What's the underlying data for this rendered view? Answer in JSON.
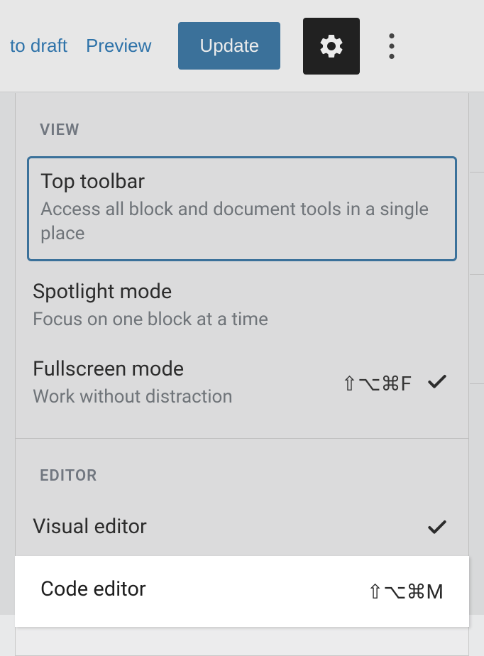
{
  "topbar": {
    "draft_label": "to draft",
    "preview_label": "Preview",
    "update_label": "Update"
  },
  "menu": {
    "view": {
      "section_title": "VIEW",
      "top_toolbar": {
        "title": "Top toolbar",
        "desc": "Access all block and document tools in a single place"
      },
      "spotlight": {
        "title": "Spotlight mode",
        "desc": "Focus on one block at a time"
      },
      "fullscreen": {
        "title": "Fullscreen mode",
        "desc": "Work without distraction",
        "shortcut": "⇧⌥⌘F"
      }
    },
    "editor": {
      "section_title": "EDITOR",
      "visual": {
        "title": "Visual editor"
      },
      "code": {
        "title": "Code editor",
        "shortcut": "⇧⌥⌘M"
      }
    }
  }
}
